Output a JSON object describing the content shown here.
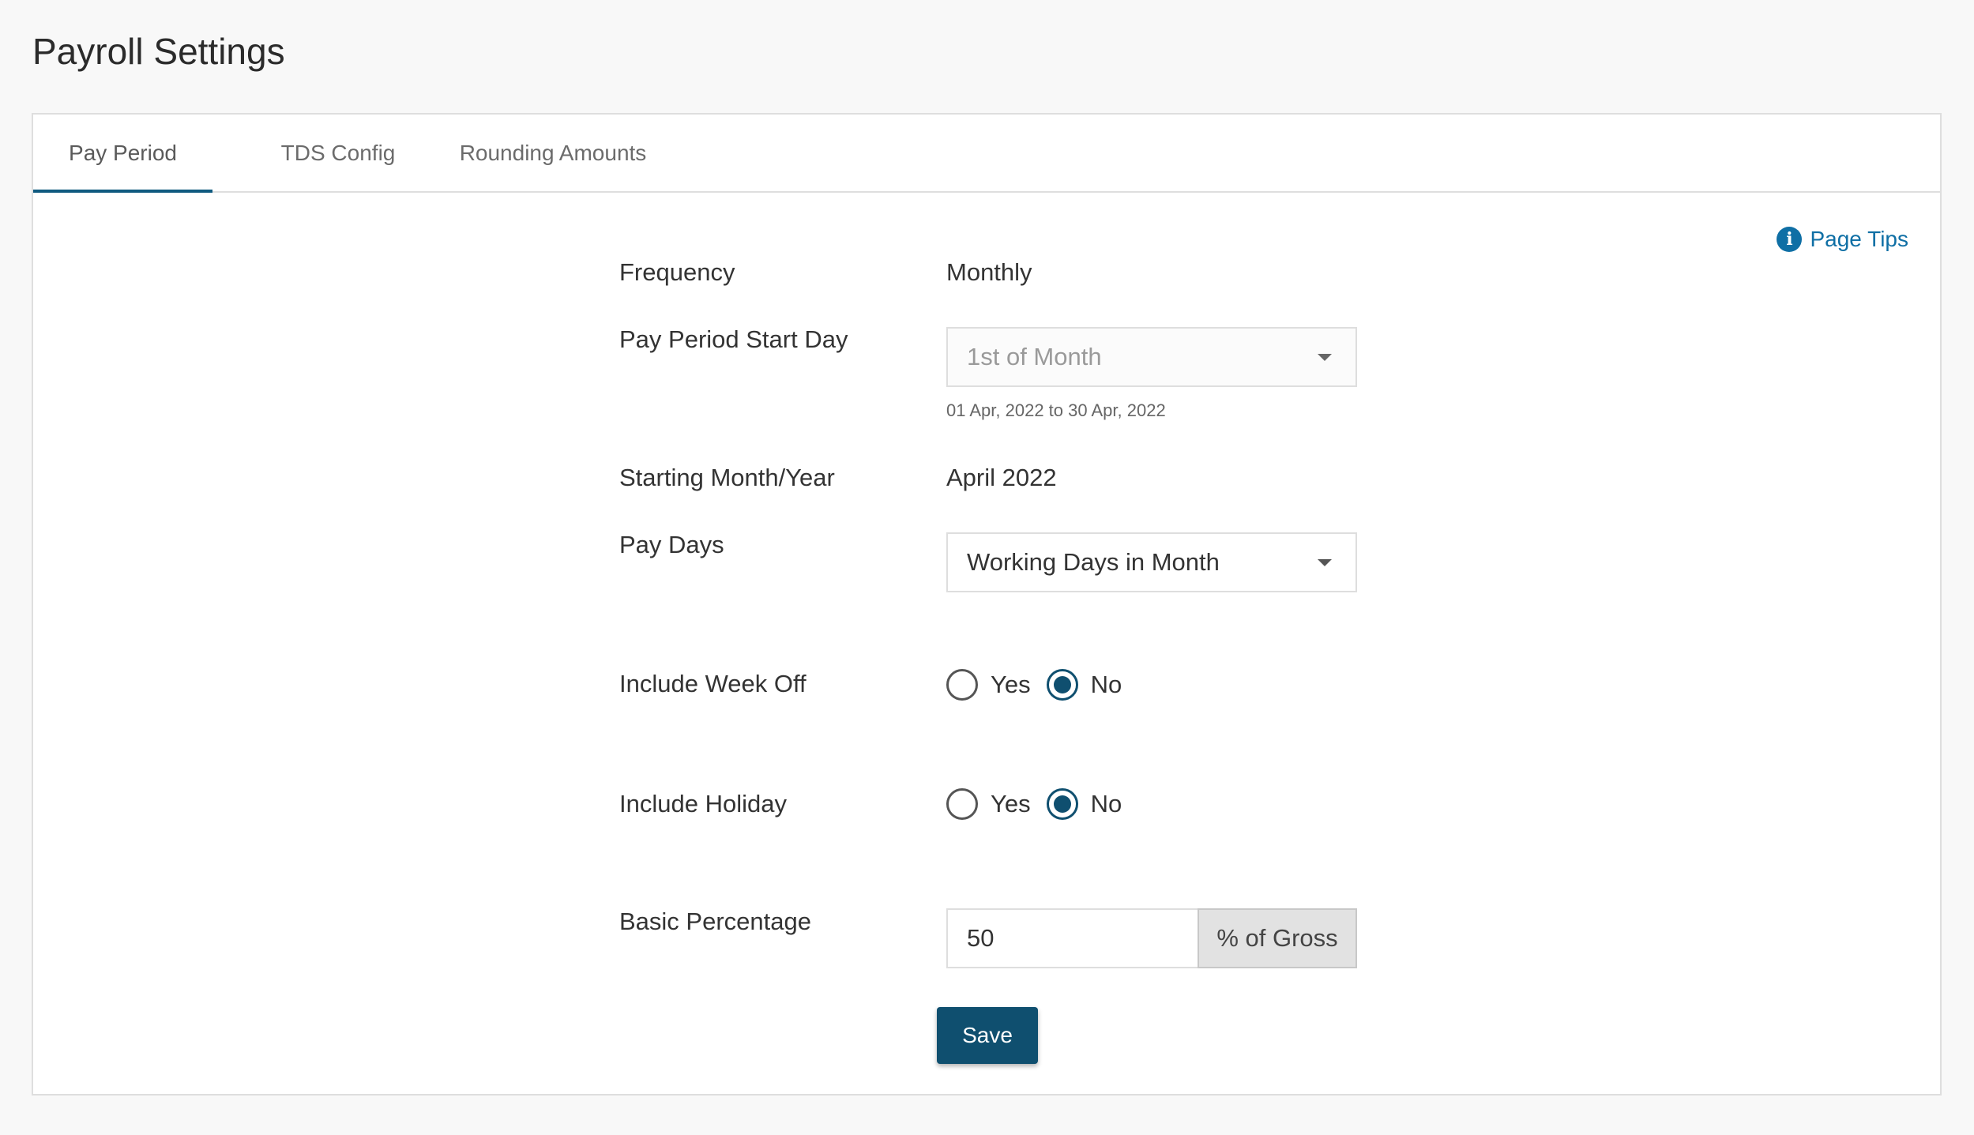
{
  "page": {
    "title": "Payroll Settings"
  },
  "tabs": [
    {
      "label": "Pay Period",
      "active": true
    },
    {
      "label": "TDS Config",
      "active": false
    },
    {
      "label": "Rounding Amounts",
      "active": false
    }
  ],
  "page_tips": {
    "label": "Page Tips",
    "icon": "info-icon",
    "color": "#0f6fa5"
  },
  "form": {
    "frequency": {
      "label": "Frequency",
      "value": "Monthly"
    },
    "pay_period_start_day": {
      "label": "Pay Period Start Day",
      "value": "1st of Month",
      "disabled": true,
      "helper": "01 Apr, 2022 to 30 Apr, 2022"
    },
    "starting_month_year": {
      "label": "Starting Month/Year",
      "value": "April 2022"
    },
    "pay_days": {
      "label": "Pay Days",
      "value": "Working Days in Month"
    },
    "include_week_off": {
      "label": "Include Week Off",
      "options": [
        "Yes",
        "No"
      ],
      "selected": "No"
    },
    "include_holiday": {
      "label": "Include Holiday",
      "options": [
        "Yes",
        "No"
      ],
      "selected": "No"
    },
    "basic_percentage": {
      "label": "Basic Percentage",
      "value": "50",
      "addon": "% of Gross"
    },
    "save_label": "Save"
  },
  "colors": {
    "primary": "#0f4f6f",
    "tab_underline": "#0f5a7f",
    "link": "#0f6fa5",
    "border": "#dedede"
  }
}
